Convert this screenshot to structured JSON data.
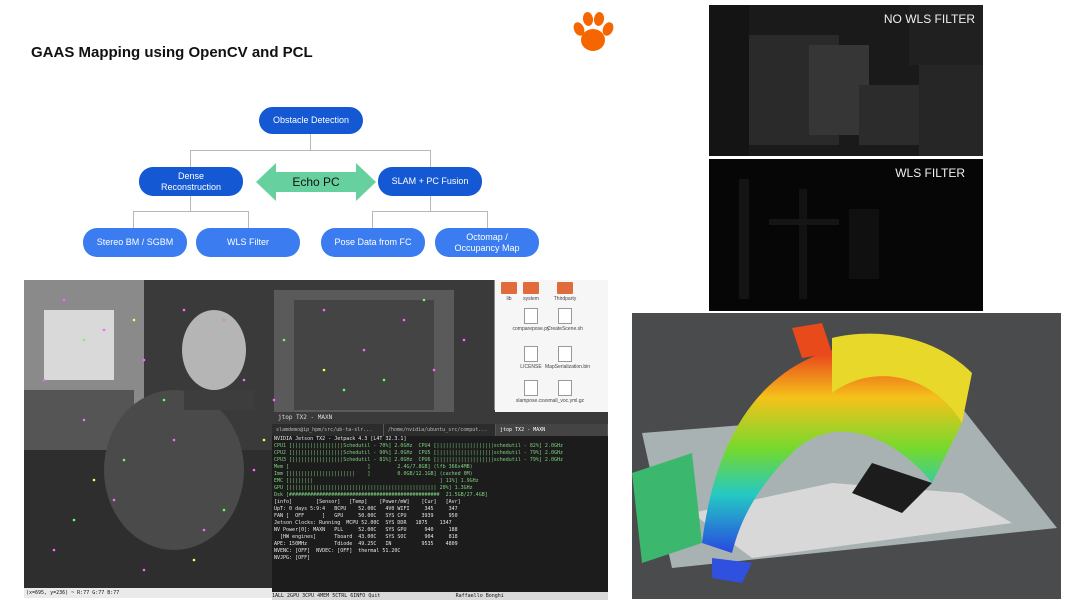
{
  "title": "GAAS Mapping using OpenCV and PCL",
  "diagram": {
    "top": "Obstacle Detection",
    "left": "Dense\nReconstruction",
    "center": "Echo PC",
    "right": "SLAM + PC Fusion",
    "bottom_items": [
      "Stereo BM / SGBM",
      "WLS Filter",
      "Pose Data from FC",
      "Octomap /\nOccupancy Map"
    ]
  },
  "depth": {
    "top_label": "NO WLS FILTER",
    "bottom_label": "WLS FILTER"
  },
  "photo": {
    "coord_text": "(x=695, y=236) ~ R:77 G:77 B:77"
  },
  "files": [
    "lib",
    "system",
    "Thirdparty",
    "comparepose.py",
    "CreateScene.sh",
    "LICENSE",
    "MapSerialization.bin",
    "slampose.csv",
    "small_voc.yml.gz"
  ],
  "terminal": {
    "title": "jtop TX2 - MAXN",
    "tabs": [
      "slamdemo@ip_hpm/src/ub-ta-slr...",
      "/home/nvidia/ubuntu_src/comput...",
      "jtop TX2 - MAXN"
    ],
    "header": "NVIDIA Jetson TX2 - Jetpack 4.3 [L4T 32.3.1]",
    "lines": [
      "CPU1 [|||||||||||||||||Schedutil - 70%] 2.0GHz  CPU4 [|||||||||||||||||||schedutil - 82%] 2.0GHz",
      "CPU2 [|||||||||||||||||Schedutil - 90%] 2.0GHz  CPU5 [|||||||||||||||||||schedutil - 79%] 2.0GHz",
      "CPU3 [|||||||||||||||||Schedutil - 81%] 2.0GHz  CPU6 [|||||||||||||||||||schedutil - 79%] 2.0GHz",
      "",
      "Mem [                          ]         2.4G/7.8GB] (lfb 366x4MB)",
      "Imm [||||||||||||||||||||||    ]         0.0GB/12.1GB] (cached 0M)",
      "EMC [||||||||                                          ] 11%] 1.9GHz",
      "",
      "GPU [||||||||||||||||||||||||||||||||||||||||||||||||| 20%] 1.3GHz",
      "Dsk [##################################################  21.5GB/27.4GB]"
    ],
    "info_header": "[info]        [Sensor]   [Temp]    [Power/mW]    [Cur]   [Avr]",
    "info_rows": [
      "UpT: 0 days 5:9:4   BCPU    52.00C   4V0 WIFI     345     347",
      "FAN [  OFF      ]   GPU     50.00C   SYS CPU     3939     950",
      "Jetson Clocks: Running  MCPU 52.00C  SYS DDR   1875    1347",
      "NV Power[0]: MAXN   PLL     52.00C   SYS GPU      940     188",
      "  [HW engines]      Tboard  43.00C   SYS SOC      904     818",
      "APE: 150MHz         Tdiode  49.25C   IN          9535    4809",
      "NVENC: [OFF]  NVDEC: [OFF]  thermal 51.20C",
      "NVJPG: [OFF]"
    ],
    "footer": "1ALL 2GPU 3CPU 4MEM 5CTRL 6INFO Quit                         Raffaello Bonghi"
  },
  "colors": {
    "accent": "#1458d4",
    "arrow": "#66d19e",
    "clemson_orange": "#f56600"
  }
}
